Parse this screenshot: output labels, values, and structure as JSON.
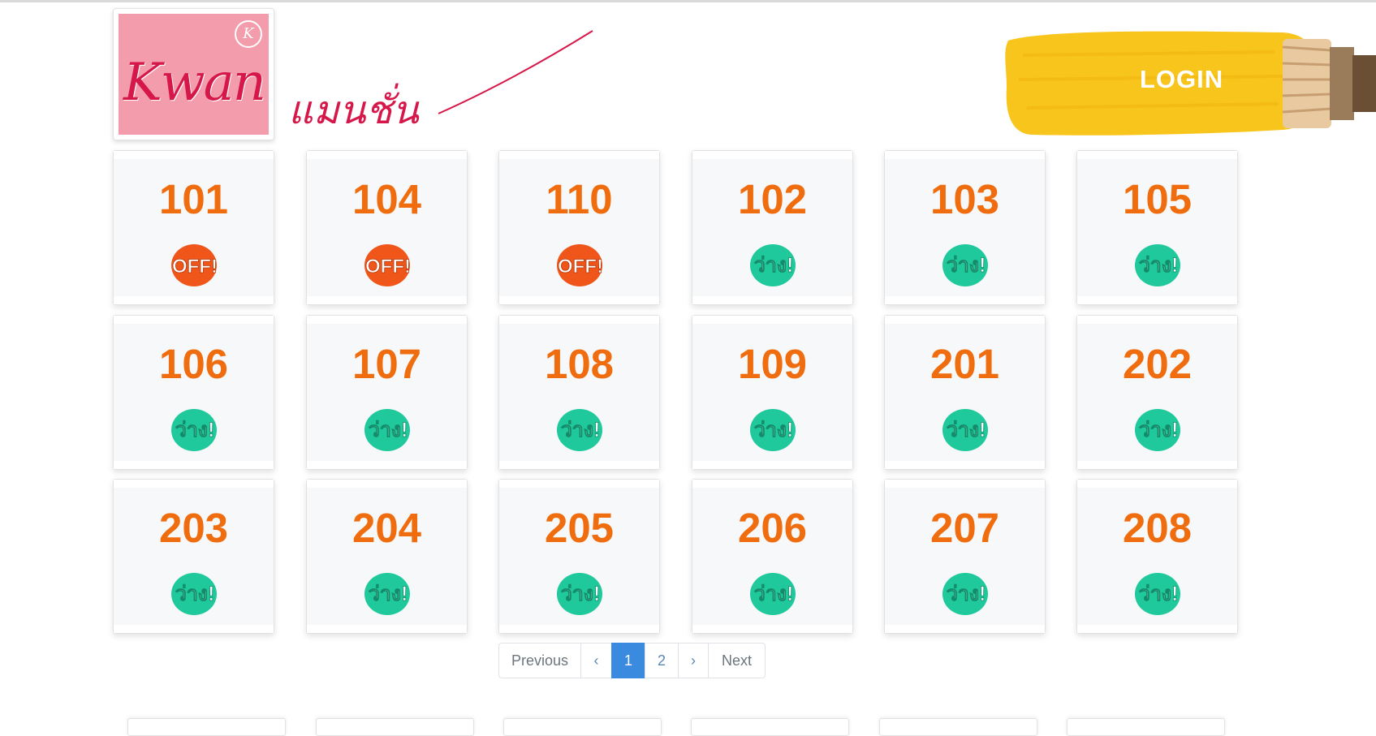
{
  "brand": {
    "logo_letter": "K",
    "logo_word": "Kwan",
    "script_name": "แมนชั่น",
    "colors": {
      "logo_bg": "#f39cac",
      "logo_text": "#d6174a"
    }
  },
  "header": {
    "login_label": "LOGIN",
    "login_paint_color": "#f8c51d"
  },
  "status_labels": {
    "off": "OFF!",
    "vacant": "ว่าง!"
  },
  "status_colors": {
    "off": "#f0561a",
    "vacant": "#1fc99b"
  },
  "rooms": [
    {
      "number": "101",
      "status": "off"
    },
    {
      "number": "104",
      "status": "off"
    },
    {
      "number": "110",
      "status": "off"
    },
    {
      "number": "102",
      "status": "vacant"
    },
    {
      "number": "103",
      "status": "vacant"
    },
    {
      "number": "105",
      "status": "vacant"
    },
    {
      "number": "106",
      "status": "vacant"
    },
    {
      "number": "107",
      "status": "vacant"
    },
    {
      "number": "108",
      "status": "vacant"
    },
    {
      "number": "109",
      "status": "vacant"
    },
    {
      "number": "201",
      "status": "vacant"
    },
    {
      "number": "202",
      "status": "vacant"
    },
    {
      "number": "203",
      "status": "vacant"
    },
    {
      "number": "204",
      "status": "vacant"
    },
    {
      "number": "205",
      "status": "vacant"
    },
    {
      "number": "206",
      "status": "vacant"
    },
    {
      "number": "207",
      "status": "vacant"
    },
    {
      "number": "208",
      "status": "vacant"
    }
  ],
  "pagination": {
    "previous_label": "Previous",
    "prev_icon": "‹",
    "pages": [
      "1",
      "2"
    ],
    "active_page": "1",
    "next_icon": "›",
    "next_label": "Next"
  }
}
